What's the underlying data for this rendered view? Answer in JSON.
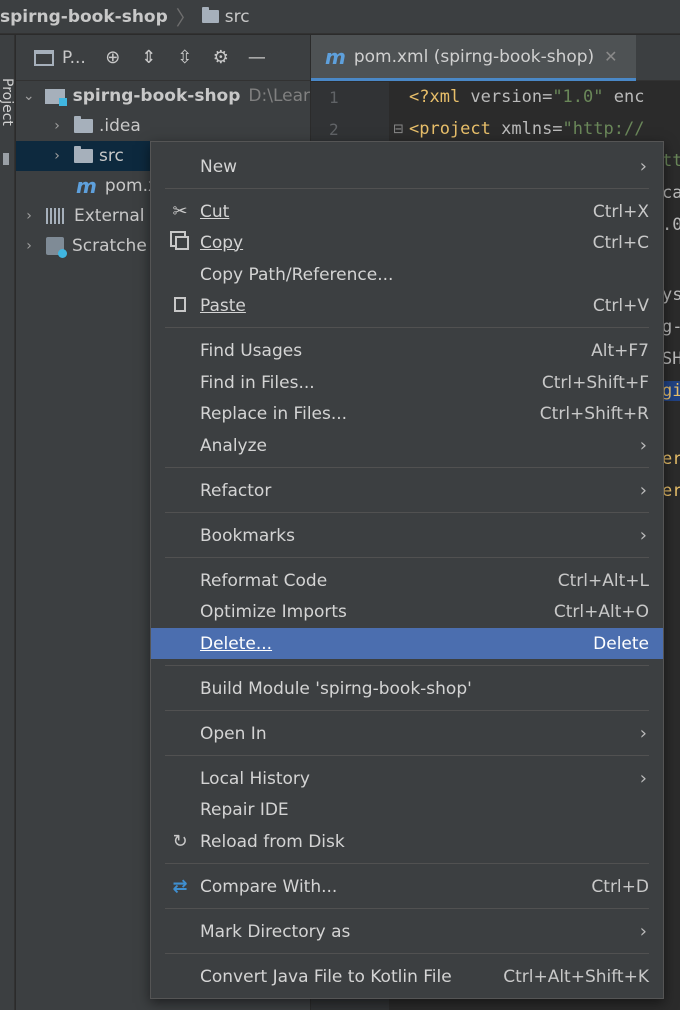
{
  "breadcrumb": {
    "project": "spirng-book-shop",
    "folder": "src"
  },
  "stripe": {
    "label": "Project"
  },
  "project_panel": {
    "title": "P...",
    "tree": [
      {
        "label": "spirng-book-shop",
        "path": "D:\\Lear"
      },
      {
        "label": ".idea"
      },
      {
        "label": "src"
      },
      {
        "label": "pom.x"
      },
      {
        "label": "External"
      },
      {
        "label": "Scratche"
      }
    ]
  },
  "editor": {
    "tab_label": "pom.xml (spirng-book-shop)",
    "line_numbers": [
      "1",
      "2"
    ],
    "line1": {
      "open": "<?xml ",
      "attr": "version=",
      "str": "\"1.0\"",
      "rest": " enc"
    },
    "line2": {
      "tag": "<project ",
      "attr": "xmlns=",
      "str": "\"http://"
    },
    "fragments": [
      "tt",
      "ca",
      ".0",
      "ys",
      "g-",
      "SH",
      "gi",
      "er",
      "er"
    ]
  },
  "menu": {
    "new": "New",
    "cut": "Cut",
    "cut_sc": "Ctrl+X",
    "copy": "Copy",
    "copy_sc": "Ctrl+C",
    "copy_path": "Copy Path/Reference...",
    "paste": "Paste",
    "paste_sc": "Ctrl+V",
    "find_usages": "Find Usages",
    "find_usages_sc": "Alt+F7",
    "find_in_files": "Find in Files...",
    "find_in_files_sc": "Ctrl+Shift+F",
    "replace_in_files": "Replace in Files...",
    "replace_in_files_sc": "Ctrl+Shift+R",
    "analyze": "Analyze",
    "refactor": "Refactor",
    "bookmarks": "Bookmarks",
    "reformat": "Reformat Code",
    "reformat_sc": "Ctrl+Alt+L",
    "optimize": "Optimize Imports",
    "optimize_sc": "Ctrl+Alt+O",
    "delete": "Delete...",
    "delete_sc": "Delete",
    "build_module": "Build Module 'spirng-book-shop'",
    "open_in": "Open In",
    "local_history": "Local History",
    "repair_ide": "Repair IDE",
    "reload": "Reload from Disk",
    "compare": "Compare With...",
    "compare_sc": "Ctrl+D",
    "mark_dir": "Mark Directory as",
    "convert": "Convert Java File to Kotlin File",
    "convert_sc": "Ctrl+Alt+Shift+K"
  },
  "colors": {
    "selection": "#4b6eaf",
    "accent": "#4a88c7",
    "maven": "#5ea0dc"
  }
}
